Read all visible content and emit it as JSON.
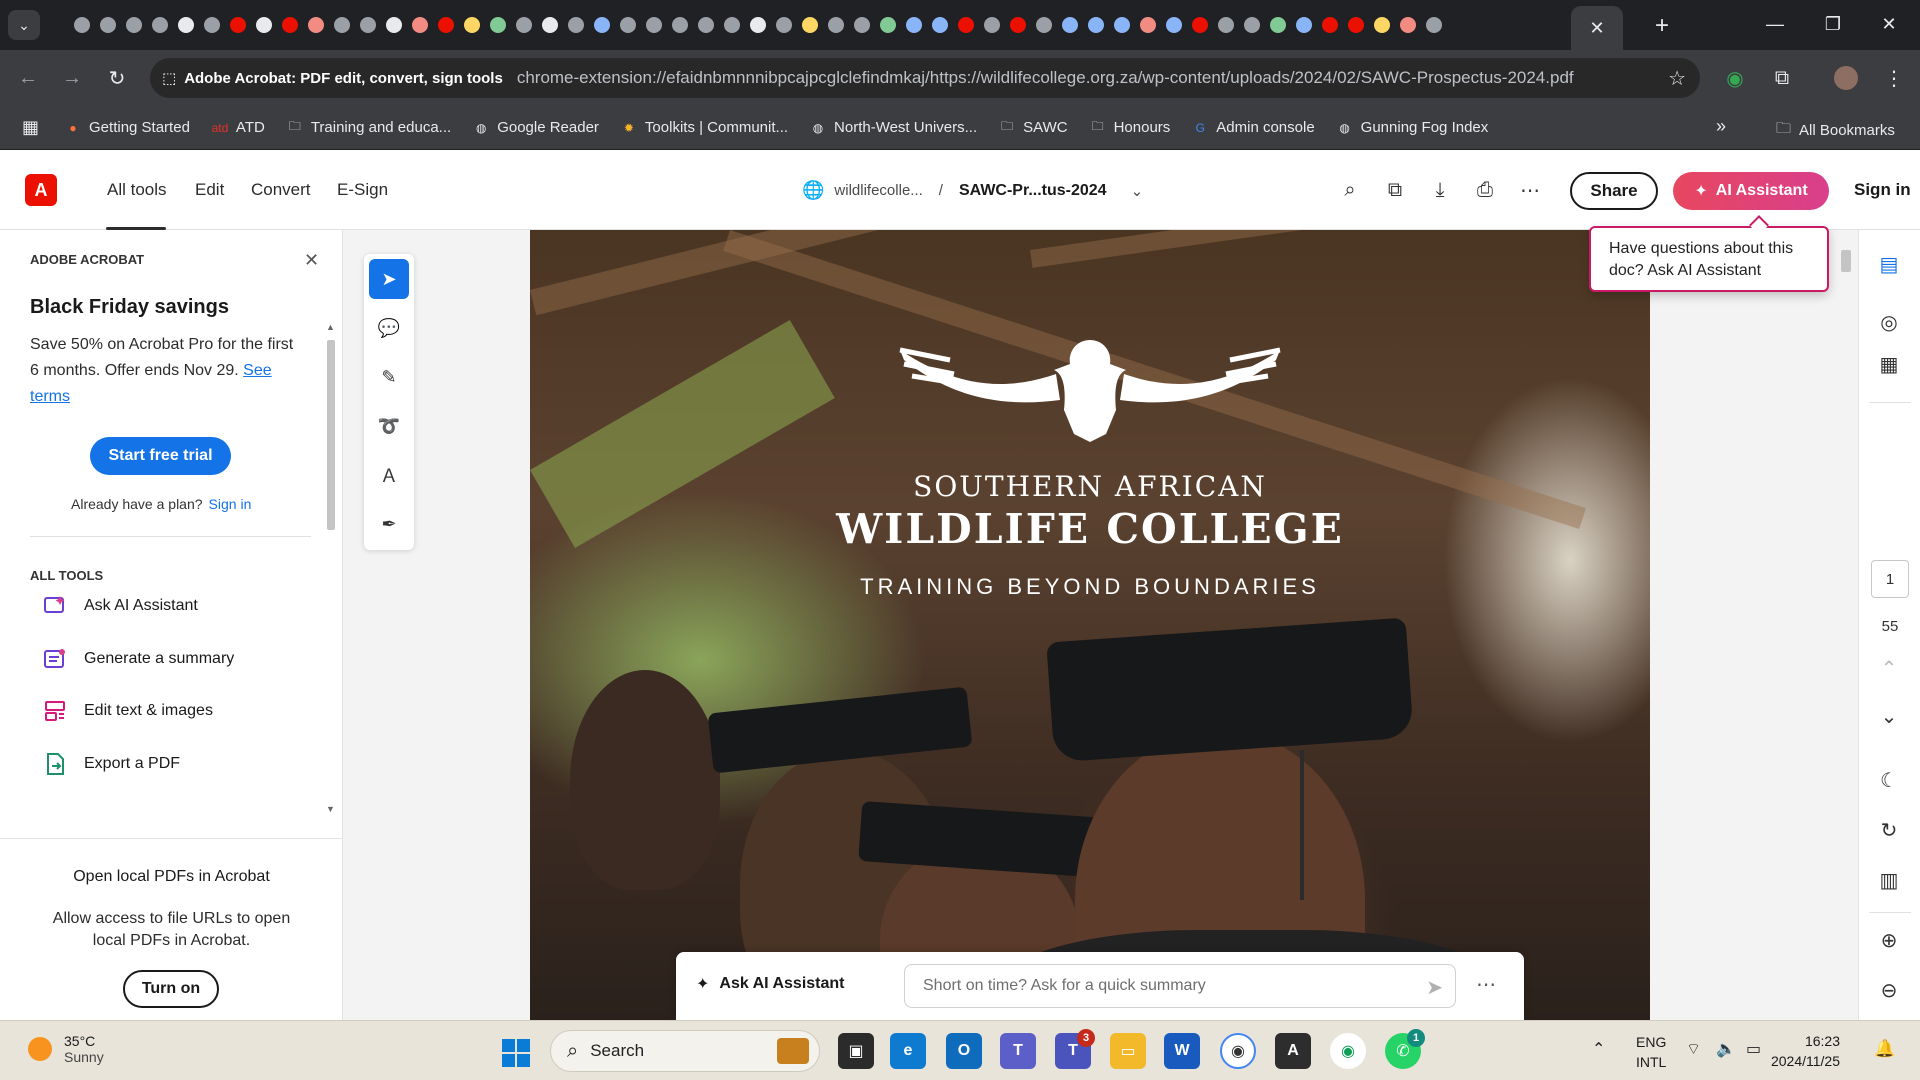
{
  "browser": {
    "tab_favicon_colors": [
      "#9aa0a6",
      "#9aa0a6",
      "#9aa0a6",
      "#9aa0a6",
      "#e8eaed",
      "#9aa0a6",
      "#eb1000",
      "#e8eaed",
      "#eb1000",
      "#f28b82",
      "#9aa0a6",
      "#9aa0a6",
      "#e8eaed",
      "#f28b82",
      "#eb1000",
      "#fdd663",
      "#81c995",
      "#9aa0a6",
      "#e8eaed",
      "#9aa0a6",
      "#8ab4f8",
      "#9aa0a6",
      "#9aa0a6",
      "#9aa0a6",
      "#9aa0a6",
      "#9aa0a6",
      "#e8eaed",
      "#9aa0a6",
      "#fdd663",
      "#9aa0a6",
      "#9aa0a6",
      "#81c995",
      "#8ab4f8",
      "#8ab4f8",
      "#eb1000",
      "#9aa0a6",
      "#eb1000",
      "#9aa0a6",
      "#8ab4f8",
      "#8ab4f8",
      "#8ab4f8",
      "#f28b82",
      "#8ab4f8",
      "#eb1000",
      "#9aa0a6",
      "#9aa0a6",
      "#81c995",
      "#8ab4f8",
      "#eb1000",
      "#eb1000",
      "#fdd663",
      "#f28b82",
      "#9aa0a6"
    ],
    "active_tab_close": "✕",
    "new_tab": "+",
    "address": {
      "site_name": "Adobe Acrobat: PDF edit, convert, sign tools",
      "url": "chrome-extension://efaidnbmnnnibpcajpcglclefindmkaj/https://wildlifecollege.org.za/wp-content/uploads/2024/02/SAWC-Prospectus-2024.pdf"
    },
    "bookmarks": [
      {
        "label": "Getting Started",
        "icon": "firefox-icon",
        "color": "#ff7139"
      },
      {
        "label": "ATD",
        "icon": "atd-icon",
        "color": "#e5322c"
      },
      {
        "label": "Training and educa...",
        "icon": "folder-icon",
        "color": "#e8eaed"
      },
      {
        "label": "Google Reader",
        "icon": "globe-icon",
        "color": "#e8eaed"
      },
      {
        "label": "Toolkits | Communit...",
        "icon": "sun-icon",
        "color": "#f7b32b"
      },
      {
        "label": "North-West Univers...",
        "icon": "globe-icon",
        "color": "#e8eaed"
      },
      {
        "label": "SAWC",
        "icon": "folder-icon",
        "color": "#e8eaed"
      },
      {
        "label": "Honours",
        "icon": "folder-icon",
        "color": "#e8eaed"
      },
      {
        "label": "Admin console",
        "icon": "google-icon",
        "color": "#4285f4"
      },
      {
        "label": "Gunning Fog Index",
        "icon": "globe-icon",
        "color": "#e8eaed"
      }
    ],
    "all_bookmarks": "All Bookmarks"
  },
  "acrobat": {
    "nav_tabs": [
      "All tools",
      "Edit",
      "Convert",
      "E-Sign"
    ],
    "breadcrumb_site": "wildlifecolle...",
    "breadcrumb_sep": "/",
    "doc_title": "SAWC-Pr...tus-2024",
    "share_label": "Share",
    "ai_label": "AI Assistant",
    "signin_label": "Sign in",
    "tooltip": "Have questions about this doc? Ask AI Assistant"
  },
  "left_panel": {
    "heading": "ADOBE ACROBAT",
    "promo_title": "Black Friday savings",
    "promo_text": "Save 50% on Acrobat Pro for the first 6 months. Offer ends Nov 29.",
    "promo_link": "See terms",
    "trial_button": "Start free trial",
    "plan_text": "Already have a plan?",
    "plan_signin": "Sign in",
    "all_tools_heading": "ALL TOOLS",
    "tools": [
      {
        "label": "Ask AI Assistant",
        "icon": "ai-assistant-icon"
      },
      {
        "label": "Generate a summary",
        "icon": "summary-icon"
      },
      {
        "label": "Edit text & images",
        "icon": "edit-text-icon"
      },
      {
        "label": "Export a PDF",
        "icon": "export-pdf-icon"
      }
    ],
    "local_title": "Open local PDFs in Acrobat",
    "local_text": "Allow access to file URLs to open local PDFs in Acrobat.",
    "turn_on_button": "Turn on"
  },
  "document": {
    "line1": "SOUTHERN AFRICAN",
    "line2": "WILDLIFE COLLEGE",
    "tagline": "TRAINING BEYOND BOUNDARIES"
  },
  "ai_bar": {
    "label": "Ask AI Assistant",
    "placeholder": "Short on time? Ask for a quick summary"
  },
  "right_rail": {
    "current_page": "1",
    "total_pages": "55"
  },
  "taskbar": {
    "temperature": "35°C",
    "condition": "Sunny",
    "search_label": "Search",
    "teams_badge": "3",
    "whatsapp_badge": "1",
    "lang_line1": "ENG",
    "lang_line2": "INTL",
    "time": "16:23",
    "date": "2024/11/25"
  }
}
